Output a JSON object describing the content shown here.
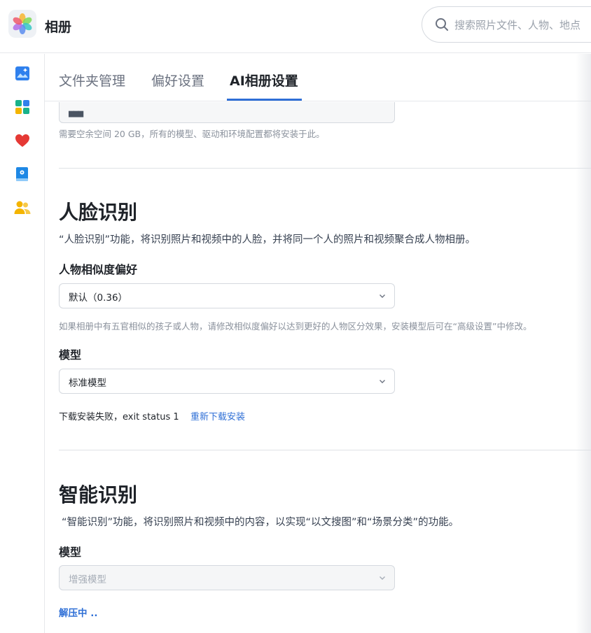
{
  "app": {
    "title": "相册",
    "logo_icon": "photos-flower-icon"
  },
  "search": {
    "placeholder": "搜索照片文件、人物、地点"
  },
  "sidebar": {
    "items": [
      {
        "name": "photos",
        "icon": "image-icon",
        "color": "#2f80ed"
      },
      {
        "name": "albums",
        "icon": "album-grid-icon",
        "color": "#19b28a"
      },
      {
        "name": "favorites",
        "icon": "heart-icon",
        "color": "#e53935"
      },
      {
        "name": "shared",
        "icon": "book-icon",
        "color": "#1e88e5"
      },
      {
        "name": "people",
        "icon": "people-icon",
        "color": "#f4b400"
      }
    ]
  },
  "tabs": [
    {
      "label": "文件夹管理",
      "active": false
    },
    {
      "label": "偏好设置",
      "active": false
    },
    {
      "label": "AI相册设置",
      "active": true
    }
  ],
  "storage": {
    "hint": "需要空余空间 20 GB，所有的模型、驱动和环境配置都将安装于此。"
  },
  "face_recognition": {
    "title": "人脸识别",
    "description": "“人脸识别”功能，将识别照片和视频中的人脸，并将同一个人的照片和视频聚合成人物相册。",
    "similarity": {
      "label": "人物相似度偏好",
      "value": "默认（0.36）",
      "hint": "如果相册中有五官相似的孩子或人物，请修改相似度偏好以达到更好的人物区分效果，安装模型后可在“高级设置”中修改。"
    },
    "model": {
      "label": "模型",
      "value": "标准模型",
      "status": "下载安装失败，exit status 1",
      "retry_link": "重新下载安装"
    }
  },
  "smart_recognition": {
    "title": "智能识别",
    "description": "“智能识别”功能，将识别照片和视频中的内容，以实现“以文搜图”和“场景分类”的功能。",
    "model": {
      "label": "模型",
      "value": "增强模型",
      "disabled": true,
      "progress": "解压中 .."
    }
  },
  "colors": {
    "accent": "#2f6fd6",
    "border": "#d5d9df"
  }
}
